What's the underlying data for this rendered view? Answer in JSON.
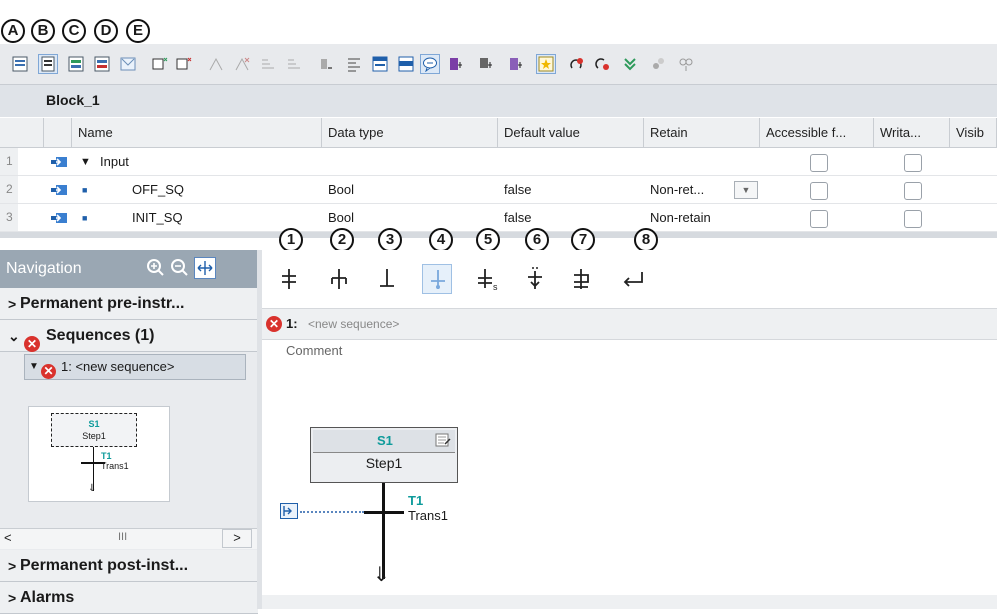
{
  "callouts_top": [
    "A",
    "B",
    "C",
    "D",
    "E"
  ],
  "callouts_seq": [
    "1",
    "2",
    "3",
    "4",
    "5",
    "6",
    "7",
    "8"
  ],
  "block": {
    "name": "Block_1"
  },
  "table": {
    "headers": [
      "Name",
      "Data type",
      "Default value",
      "Retain",
      "Accessible f...",
      "Writa...",
      "Visib"
    ],
    "rows": [
      {
        "num": "1",
        "name": "Input",
        "type": "",
        "default": "",
        "retain": "",
        "expanded": true
      },
      {
        "num": "2",
        "name": "OFF_SQ",
        "type": "Bool",
        "default": "false",
        "retain": "Non-ret..."
      },
      {
        "num": "3",
        "name": "INIT_SQ",
        "type": "Bool",
        "default": "false",
        "retain": "Non-retain"
      }
    ]
  },
  "navigation": {
    "title": "Navigation",
    "sections": [
      {
        "label": "Permanent pre-instr...",
        "arrow": "›"
      },
      {
        "label": "Sequences (1)",
        "arrow": "⌄",
        "error": true
      }
    ],
    "sequence_item": "1: <new sequence>",
    "thumb": {
      "step_id": "S1",
      "step_name": "Step1",
      "trans_id": "T1",
      "trans_name": "Trans1"
    },
    "scroll_mid": "III",
    "post_section": "Permanent post-inst...",
    "alarms_section": "Alarms"
  },
  "sequence": {
    "number": "1:",
    "name": "<new sequence>",
    "comment": "Comment",
    "step": {
      "id": "S1",
      "name": "Step1"
    },
    "transition": {
      "id": "T1",
      "name": "Trans1"
    }
  },
  "colors": {
    "accent": "#1f7fd6",
    "error": "#d9322d",
    "teal": "#0e9b9b"
  }
}
